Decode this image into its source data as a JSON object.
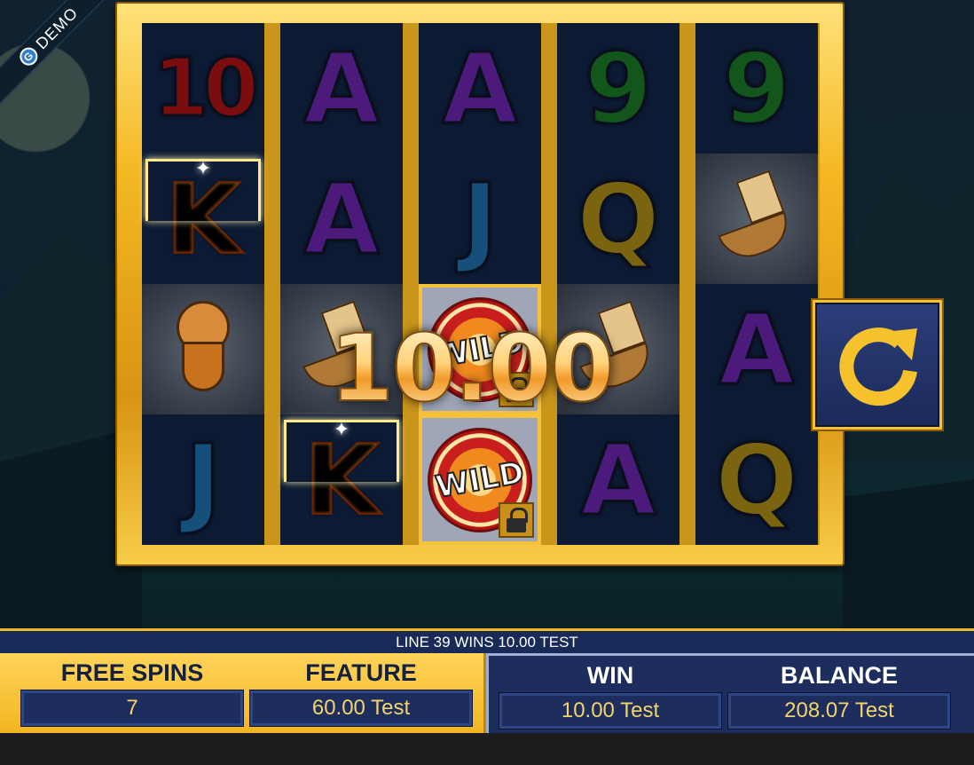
{
  "demo_badge": "DEMO",
  "reels": [
    [
      "10",
      "K",
      "warrior",
      "J"
    ],
    [
      "A",
      "A",
      "ship",
      "K"
    ],
    [
      "A",
      "J",
      "WILD",
      "WILD"
    ],
    [
      "9",
      "Q",
      "ship",
      "A"
    ],
    [
      "9",
      "ship",
      "A",
      "Q"
    ]
  ],
  "winning_cells": [
    [
      0,
      1
    ],
    [
      1,
      3
    ]
  ],
  "locked_wild_cells": [
    [
      2,
      2
    ],
    [
      2,
      3
    ]
  ],
  "wild_label": "WILD",
  "big_win_amount": "10.00",
  "line_info": "LINE 39 WINS 10.00 TEST",
  "stats": {
    "free_spins": {
      "label": "FREE SPINS",
      "value": "7"
    },
    "feature": {
      "label": "FEATURE",
      "value": "60.00 Test"
    },
    "win": {
      "label": "WIN",
      "value": "10.00 Test"
    },
    "balance": {
      "label": "BALANCE",
      "value": "208.07 Test"
    }
  },
  "colors": {
    "frame_gold": "#f4b823",
    "panel_navy": "#1c2d5e",
    "value_text": "#f3d36a"
  },
  "icons": {
    "spin": "circular-arrow-icon",
    "lock": "lock-icon",
    "demo_logo": "demo-logo-icon"
  }
}
